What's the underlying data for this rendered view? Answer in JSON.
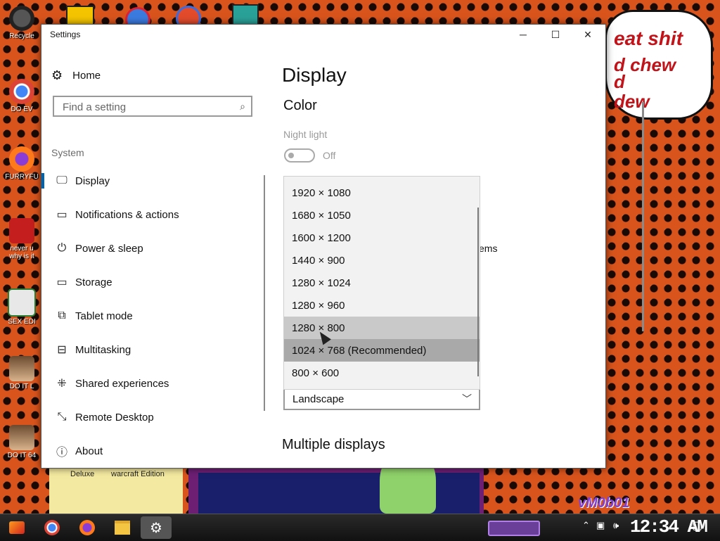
{
  "desktop": {
    "icons": [
      {
        "label": "Recycle",
        "icon": "recycle-bin-icon"
      },
      {
        "label": "DO EV",
        "icon": "chrome-icon"
      },
      {
        "label": "FURRYFU",
        "icon": "firefox-icon"
      },
      {
        "label": "never u\nwhy is it",
        "icon": "dev-cpp-icon"
      },
      {
        "label": "SEX EDI",
        "icon": "hx-editor-icon"
      },
      {
        "label": "DO IT L",
        "icon": "portrait-icon"
      },
      {
        "label": "DO IT 64",
        "icon": "portrait-icon"
      }
    ],
    "bottom_labels": [
      "Deluxe",
      "warcraft Edition"
    ],
    "speech_lines": [
      "eat shit",
      "d chew",
      "d",
      "dew"
    ],
    "signature": "vM0b01"
  },
  "window": {
    "title": "Settings",
    "controls": {
      "minimize": "─",
      "maximize": "☐",
      "close": "✕"
    },
    "nav": {
      "home": "Home",
      "search_placeholder": "Find a setting",
      "section": "System",
      "items": [
        {
          "label": "Display",
          "icon": "monitor-icon",
          "active": true
        },
        {
          "label": "Notifications & actions",
          "icon": "notification-icon"
        },
        {
          "label": "Power & sleep",
          "icon": "power-icon"
        },
        {
          "label": "Storage",
          "icon": "storage-icon"
        },
        {
          "label": "Tablet mode",
          "icon": "tablet-mode-icon"
        },
        {
          "label": "Multitasking",
          "icon": "multitasking-icon"
        },
        {
          "label": "Shared experiences",
          "icon": "shared-experiences-icon"
        },
        {
          "label": "Remote Desktop",
          "icon": "remote-desktop-icon"
        },
        {
          "label": "About",
          "icon": "info-icon"
        }
      ]
    },
    "content": {
      "title": "Display",
      "color_heading": "Color",
      "night_light_label": "Night light",
      "night_light_state": "Off",
      "partial_text": "ems",
      "orientation_value": "Landscape",
      "multiple_displays_heading": "Multiple displays"
    },
    "resolution_dropdown": {
      "options": [
        "1920 × 1080",
        "1680 × 1050",
        "1600 × 1200",
        "1440 × 900",
        "1280 × 1024",
        "1280 × 960",
        "1280 × 800",
        "1024 × 768 (Recommended)",
        "800 × 600"
      ],
      "hovered": "1280 × 800",
      "selected": "1024 × 768 (Recommended)"
    }
  },
  "taskbar": {
    "apps": [
      "start-icon",
      "chrome-icon",
      "firefox-icon",
      "file-explorer-icon",
      "settings-gear-icon"
    ],
    "clock": "12:34 AM",
    "tray": [
      "chevron-up-icon",
      "network-icon",
      "volume-icon",
      "notification-center-icon"
    ]
  }
}
